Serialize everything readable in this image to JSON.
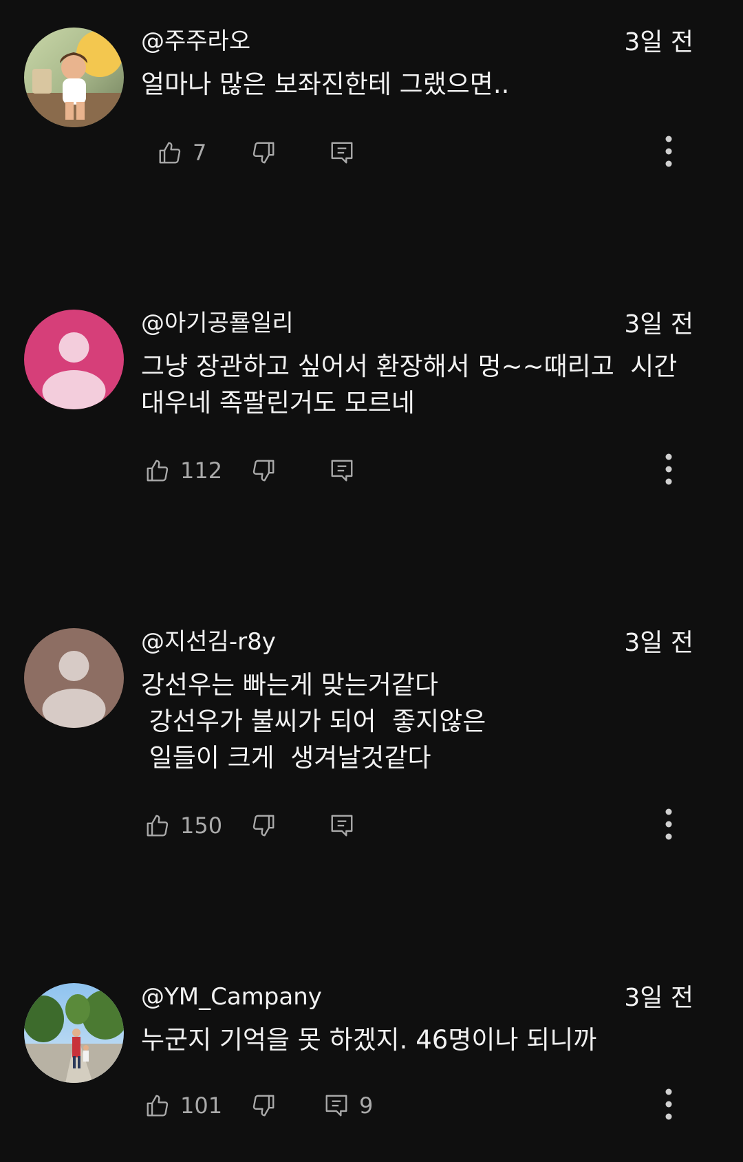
{
  "colors": {
    "background": "#0f0f0f",
    "text": "#f1f1f1",
    "secondary_text": "#aaaaaa",
    "icon": "#aaaaaa",
    "avatar_pink": "#d63f79",
    "avatar_brown": "#8d6e63"
  },
  "comments": [
    {
      "author": "@주주라오",
      "time": "3일 전",
      "text": "얼마나 많은 보좌진한테 그랬으면..",
      "likes": "7",
      "replies": "",
      "avatar": "photo-avatar-cartoon-girl"
    },
    {
      "author": "@아기공룔일리",
      "time": "3일 전",
      "text": "그냥 장관하고 싶어서 환장해서 멍~~때리고  시간대우네 족팔린거도 모르네",
      "likes": "112",
      "replies": "",
      "avatar": "default-person-avatar"
    },
    {
      "author": "@지선김-r8y",
      "time": "3일 전",
      "text": "강선우는 빠는게 맞는거같다\n 강선우가 불씨가 되어  좋지않은\n 일들이 크게  생겨날것같다",
      "likes": "150",
      "replies": "",
      "avatar": "default-person-avatar"
    },
    {
      "author": "@YM_Campany",
      "time": "3일 전",
      "text": "누군지 기억을 못 하겠지. 46명이나 되니까",
      "likes": "101",
      "replies": "9",
      "avatar": "photo-avatar-park"
    }
  ],
  "icons": {
    "like": "thumbs-up-icon",
    "dislike": "thumbs-down-icon",
    "reply": "reply-icon",
    "more": "more-vert-icon"
  }
}
